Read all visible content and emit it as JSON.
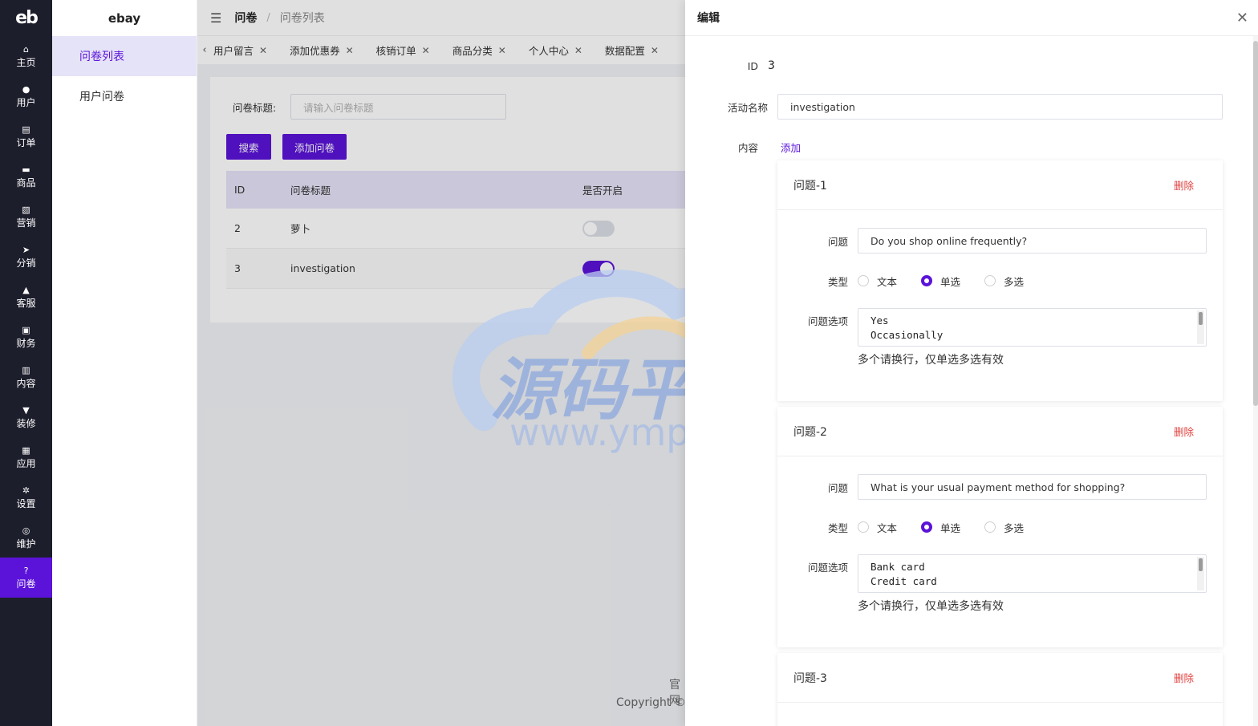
{
  "rail": {
    "logo": "eb",
    "items": [
      {
        "label": "主页",
        "icon": "home-icon",
        "glyph": "⌂"
      },
      {
        "label": "用户",
        "icon": "user-icon",
        "glyph": "●"
      },
      {
        "label": "订单",
        "icon": "order-icon",
        "glyph": "▤"
      },
      {
        "label": "商品",
        "icon": "product-icon",
        "glyph": "▬"
      },
      {
        "label": "营销",
        "icon": "marketing-icon",
        "glyph": "▧"
      },
      {
        "label": "分销",
        "icon": "send-icon",
        "glyph": "➤"
      },
      {
        "label": "客服",
        "icon": "bell-icon",
        "glyph": "▲"
      },
      {
        "label": "财务",
        "icon": "wallet-icon",
        "glyph": "▣"
      },
      {
        "label": "内容",
        "icon": "content-icon",
        "glyph": "▥"
      },
      {
        "label": "装修",
        "icon": "brush-icon",
        "glyph": "▼"
      },
      {
        "label": "应用",
        "icon": "apps-icon",
        "glyph": "▦"
      },
      {
        "label": "设置",
        "icon": "gear-icon",
        "glyph": "✲"
      },
      {
        "label": "维护",
        "icon": "chip-icon",
        "glyph": "◎"
      },
      {
        "label": "问卷",
        "icon": "question-icon",
        "glyph": "?"
      }
    ]
  },
  "submenu": {
    "brand": "ebay",
    "items": [
      "问卷列表",
      "用户问卷"
    ]
  },
  "header": {
    "crumb1": "问卷",
    "crumb2": "问卷列表",
    "separator": "/"
  },
  "tabs": [
    "用户留言",
    "添加优惠券",
    "核销订单",
    "商品分类",
    "个人中心",
    "数据配置"
  ],
  "filter": {
    "label": "问卷标题:",
    "placeholder": "请输入问卷标题"
  },
  "buttons": {
    "search": "搜索",
    "add": "添加问卷"
  },
  "table": {
    "headers": [
      "ID",
      "问卷标题",
      "是否开启"
    ],
    "rows": [
      {
        "id": "2",
        "title": "萝卜",
        "enabled": false
      },
      {
        "id": "3",
        "title": "investigation",
        "enabled": true
      }
    ]
  },
  "footer": {
    "line1": "官网",
    "line2": "Copyright ©"
  },
  "watermark": {
    "text1": "源码平台",
    "text2": "www.ympt.cc"
  },
  "drawer": {
    "title": "编辑",
    "id_label": "ID",
    "id_value": "3",
    "name_label": "活动名称",
    "name_value": "investigation",
    "content_label": "内容",
    "add_link": "添加",
    "question_label": "问题",
    "type_label": "类型",
    "options_label": "问题选项",
    "hint": "多个请换行，仅单选多选有效",
    "delete": "删除",
    "type_options": [
      "文本",
      "单选",
      "多选"
    ],
    "questions": [
      {
        "title": "问题-1",
        "question": "Do you shop online frequently?",
        "type": "单选",
        "options": [
          "Yes",
          "Occasionally"
        ]
      },
      {
        "title": "问题-2",
        "question": "What is your usual payment method for shopping?",
        "type": "单选",
        "options": [
          "Bank card",
          "Credit card"
        ]
      },
      {
        "title": "问题-3"
      }
    ]
  },
  "colors": {
    "accent": "#5b13d9",
    "rail_bg": "#1d1e2c",
    "danger": "#e0413f",
    "table_head": "#e5e3f7"
  }
}
